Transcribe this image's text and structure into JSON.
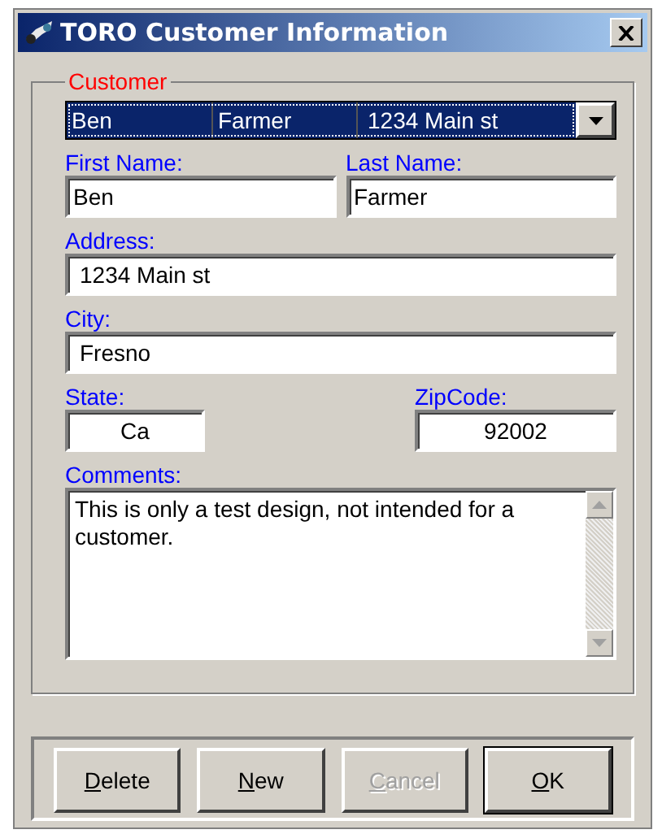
{
  "window": {
    "title": "TORO Customer Information"
  },
  "customer_group": {
    "legend": "Customer",
    "combo": {
      "columns": [
        "Ben",
        "Farmer",
        "1234 Main st"
      ]
    },
    "first_name": {
      "label": "First Name:",
      "value": "Ben"
    },
    "last_name": {
      "label": "Last Name:",
      "value": "Farmer"
    },
    "address": {
      "label": "Address:",
      "value": "1234 Main st"
    },
    "city": {
      "label": "City:",
      "value": "Fresno"
    },
    "state": {
      "label": "State:",
      "value": "Ca"
    },
    "zip_code": {
      "label": "ZipCode:",
      "value": "92002"
    },
    "comments": {
      "label": "Comments:",
      "value": "This is only a test design, not intended for a customer."
    }
  },
  "buttons": [
    {
      "label": "Delete",
      "disabled": false,
      "default": false
    },
    {
      "label": "New",
      "disabled": false,
      "default": false
    },
    {
      "label": "Cancel",
      "disabled": true,
      "default": false
    },
    {
      "label": "OK",
      "disabled": false,
      "default": true
    }
  ]
}
